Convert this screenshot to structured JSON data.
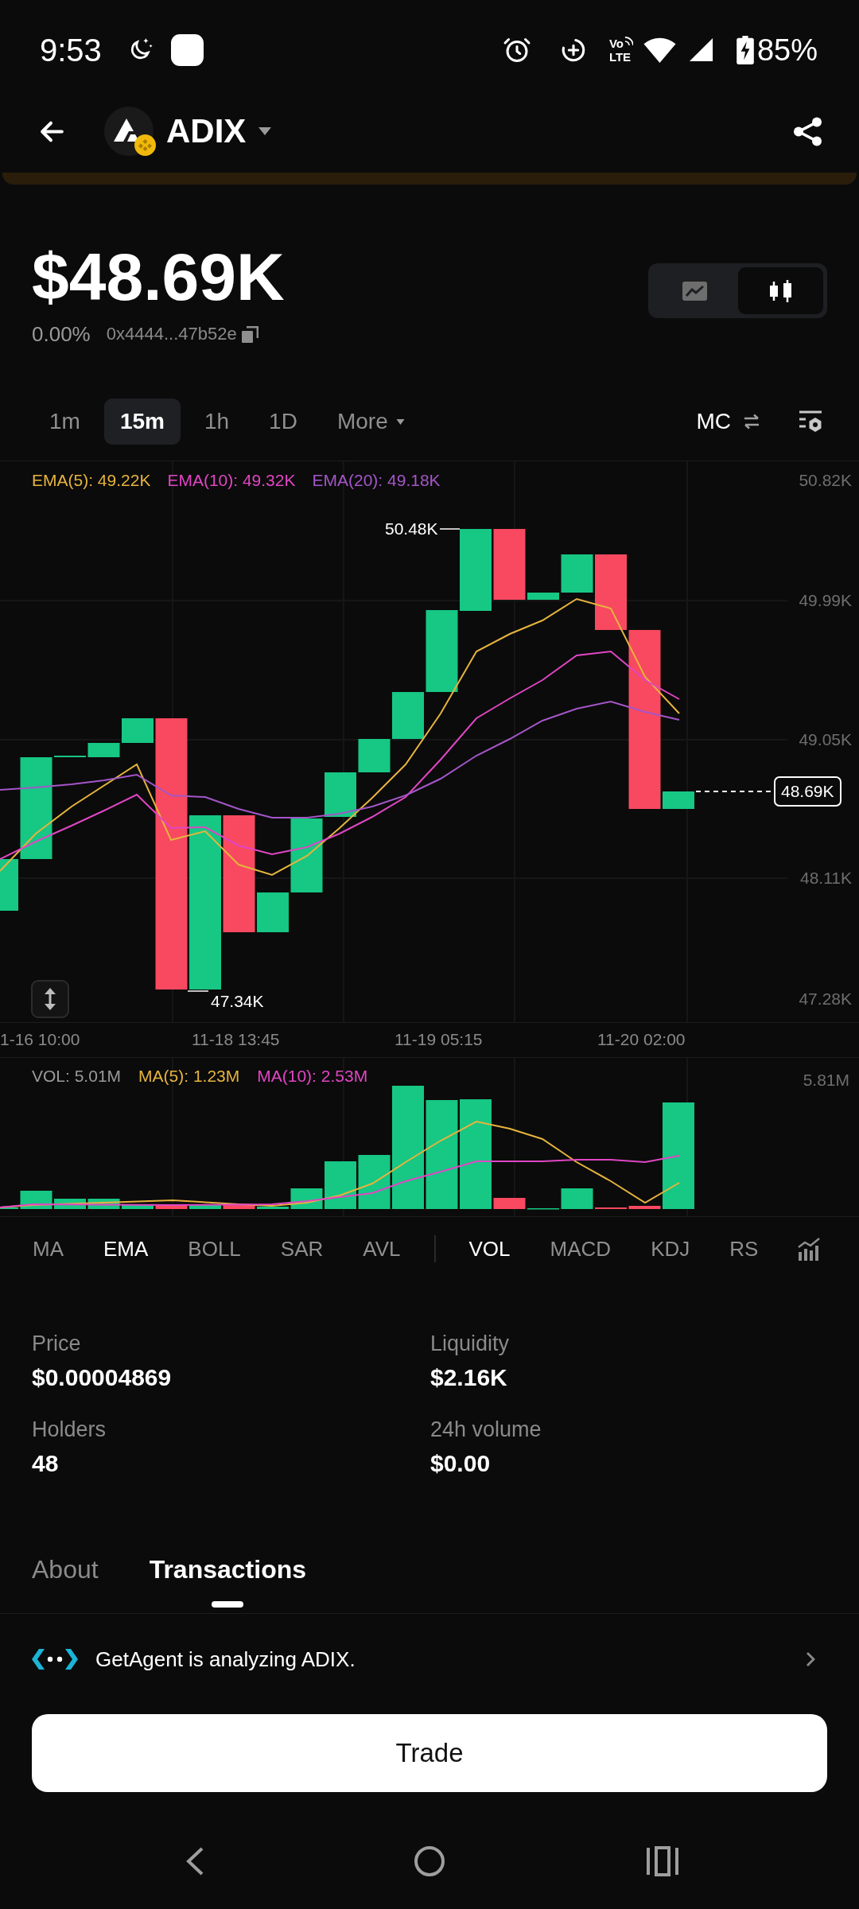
{
  "status_bar": {
    "time": "9:53",
    "network_labels": [
      "Vo",
      "LTE"
    ],
    "battery": "85%"
  },
  "header": {
    "token": "ADIX"
  },
  "price": {
    "value": "$48.69K",
    "change": "0.00%",
    "address": "0x4444...47b52e"
  },
  "chart_types": [
    {
      "kind": "line",
      "selected": false
    },
    {
      "kind": "candle",
      "selected": true
    }
  ],
  "timeframes": [
    {
      "label": "1m",
      "selected": false
    },
    {
      "label": "15m",
      "selected": true
    },
    {
      "label": "1h",
      "selected": false
    },
    {
      "label": "1D",
      "selected": false
    }
  ],
  "more_menu": {
    "label": "More"
  },
  "value_mode": {
    "label": "MC"
  },
  "chart": {
    "legend": [
      {
        "label": "EMA(5): 49.22K",
        "color": "#e6b43d"
      },
      {
        "label": "EMA(10): 49.32K",
        "color": "#e046c4"
      },
      {
        "label": "EMA(20): 49.18K",
        "color": "#a456c8"
      }
    ],
    "price_axis": [
      "50.82K",
      "49.99K",
      "49.05K",
      "48.11K",
      "47.28K"
    ],
    "high_label": "50.48K",
    "low_label": "47.34K",
    "last_price": "48.69K",
    "time_axis": [
      "1-16 10:00",
      "11-18 13:45",
      "11-19 05:15",
      "11-20 02:00"
    ]
  },
  "volume": {
    "legend": [
      {
        "label": "VOL: 5.01M",
        "color": "#9a9a9a"
      },
      {
        "label": "MA(5): 1.23M",
        "color": "#e6b43d"
      },
      {
        "label": "MA(10): 2.53M",
        "color": "#e046c4"
      }
    ],
    "axis_max": "5.81M"
  },
  "indicators": {
    "main": [
      {
        "label": "MA",
        "selected": false
      },
      {
        "label": "EMA",
        "selected": true
      },
      {
        "label": "BOLL",
        "selected": false
      },
      {
        "label": "SAR",
        "selected": false
      },
      {
        "label": "AVL",
        "selected": false
      }
    ],
    "sub": [
      {
        "label": "VOL",
        "selected": true
      },
      {
        "label": "MACD",
        "selected": false
      },
      {
        "label": "KDJ",
        "selected": false
      },
      {
        "label": "RS",
        "selected": false
      }
    ]
  },
  "stats": [
    {
      "label": "Price",
      "value": "$0.00004869"
    },
    {
      "label": "Liquidity",
      "value": "$2.16K"
    },
    {
      "label": "Holders",
      "value": "48"
    },
    {
      "label": "24h volume",
      "value": "$0.00"
    }
  ],
  "tabs": [
    {
      "label": "About",
      "selected": false
    },
    {
      "label": "Transactions",
      "selected": true
    }
  ],
  "agent_banner": {
    "text": "GetAgent is analyzing ADIX."
  },
  "trade_button": {
    "label": "Trade"
  }
}
